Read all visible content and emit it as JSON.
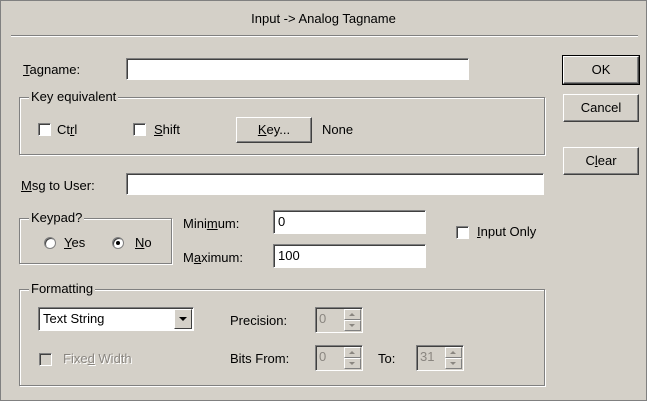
{
  "dialog": {
    "title": "Input -> Analog Tagname"
  },
  "tagname": {
    "label": "Tagname:",
    "accel": "T",
    "rest": "agname:",
    "value": ""
  },
  "key_equivalent": {
    "legend": "Key equivalent",
    "ctrl": {
      "accel": "",
      "pre": "Ct",
      "acc": "r",
      "post": "l",
      "checked": false
    },
    "shift": {
      "pre": "",
      "acc": "S",
      "post": "hift",
      "checked": false
    },
    "key_button": {
      "acc": "K",
      "post": "ey..."
    },
    "key_value": "None"
  },
  "msg_to_user": {
    "acc": "M",
    "post": "sg to User:",
    "value": ""
  },
  "keypad": {
    "legend": "Keypad?",
    "yes": {
      "acc": "Y",
      "post": "es",
      "selected": false
    },
    "no": {
      "acc": "N",
      "post": "o",
      "selected": true
    }
  },
  "minimum": {
    "pre": "Mini",
    "acc": "m",
    "post": "um:",
    "value": "0"
  },
  "maximum": {
    "pre": "M",
    "acc": "a",
    "post": "ximum:",
    "value": "100"
  },
  "input_only": {
    "acc": "I",
    "post": "nput Only",
    "checked": false
  },
  "formatting": {
    "legend": "Formatting",
    "format_select": {
      "value": "Text String"
    },
    "precision": {
      "label": "Precision:",
      "value": "0"
    },
    "fixed_width": {
      "pre": "Fixe",
      "acc": "d",
      "post": " Width",
      "checked": false,
      "enabled": false
    },
    "bits_from": {
      "label": "Bits From:",
      "value": "0"
    },
    "to": {
      "label": "To:",
      "value": "31"
    }
  },
  "buttons": {
    "ok": "OK",
    "cancel": "Cancel",
    "clear": {
      "pre": "C",
      "acc": "l",
      "post": "ear"
    }
  },
  "icons": [
    "dropdown-arrow-icon",
    "spin-up-icon",
    "spin-down-icon"
  ]
}
